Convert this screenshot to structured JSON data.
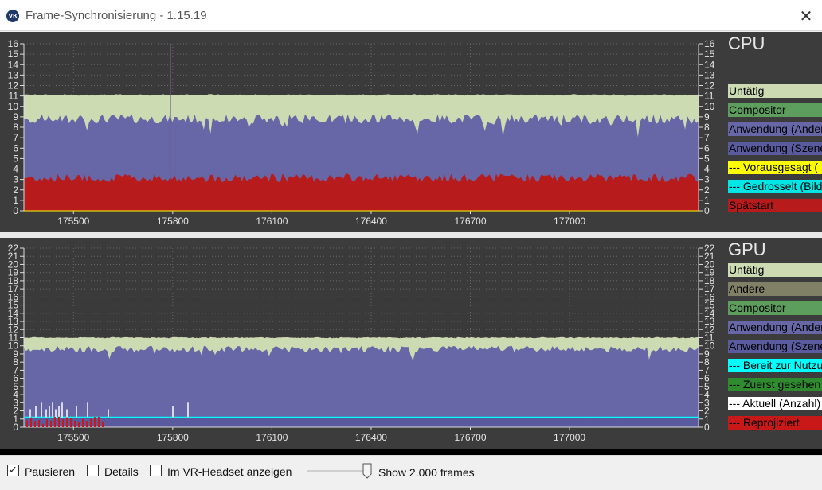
{
  "window": {
    "title": "Frame-Synchronisierung - 1.15.19",
    "app_icon_text": "VR",
    "close_glyph": "✕"
  },
  "colors": {
    "idle": "#ccdbb1",
    "compositor": "#5d9d5d",
    "app_other": "#6767a7",
    "app_scene": "#5a5a9e",
    "predicted": "#ffff00",
    "throttled": "#00e5e5",
    "late_start": "#b81b1b",
    "other": "#808066",
    "ready": "#00ffff",
    "first_seen": "#2e8b2e",
    "current": "#ffffff",
    "reprojected": "#c81818",
    "plot_bg": "#3a3a3a",
    "text": "#e6e6e6"
  },
  "cpu": {
    "legend_title": "CPU",
    "legend": [
      {
        "label": "Untätig",
        "color": "idle"
      },
      {
        "label": "Compositor",
        "color": "compositor"
      },
      {
        "label": "Anwendung (Andere)",
        "color": "app_other"
      },
      {
        "label": "Anwendung (Szene)",
        "color": "app_scene"
      },
      {
        "label": "--- Vorausgesagt (",
        "color": "predicted"
      },
      {
        "label": "--- Gedrosselt (Bild",
        "color": "throttled"
      },
      {
        "label": "Spätstart",
        "color": "late_start"
      }
    ]
  },
  "gpu": {
    "legend_title": "GPU",
    "legend": [
      {
        "label": "Untätig",
        "color": "idle"
      },
      {
        "label": "Andere",
        "color": "other"
      },
      {
        "label": "Compositor",
        "color": "compositor"
      },
      {
        "label": "Anwendung (Andere)",
        "color": "app_other"
      },
      {
        "label": "Anwendung (Szene)",
        "color": "app_scene"
      },
      {
        "label": "--- Bereit zur Nutzung",
        "color": "ready"
      },
      {
        "label": "--- Zuerst gesehen",
        "color": "first_seen"
      },
      {
        "label": "--- Aktuell (Anzahl)",
        "color": "current"
      },
      {
        "label": "--- Reprojiziert",
        "color": "reprojected"
      }
    ]
  },
  "chart_data": [
    {
      "type": "area",
      "name": "CPU",
      "x_ticks": [
        175500,
        175800,
        176100,
        176400,
        176700,
        177000
      ],
      "xlim": [
        175350,
        177390
      ],
      "ylim": [
        0,
        16
      ],
      "y_ticks": [
        0,
        1,
        2,
        3,
        4,
        5,
        6,
        7,
        8,
        9,
        10,
        11,
        12,
        13,
        14,
        15,
        16
      ],
      "grid": true,
      "series": [
        {
          "name": "Spätstart",
          "values": [
            3.3,
            3.2,
            3.1,
            3.0
          ]
        },
        {
          "name": "Anwendung (Szene)",
          "values": [
            8.8,
            8.8,
            8.8,
            8.8
          ]
        },
        {
          "name": "Untätig",
          "values": [
            11.1,
            11.1,
            11.1,
            11.1
          ]
        }
      ]
    },
    {
      "type": "area",
      "name": "GPU",
      "x_ticks": [
        175500,
        175800,
        176100,
        176400,
        176700,
        177000
      ],
      "xlim": [
        175350,
        177390
      ],
      "ylim": [
        0,
        22
      ],
      "y_ticks": [
        0,
        1,
        2,
        3,
        4,
        5,
        6,
        7,
        8,
        9,
        10,
        11,
        12,
        13,
        14,
        15,
        16,
        17,
        18,
        19,
        20,
        21,
        22
      ],
      "grid": true,
      "series": [
        {
          "name": "Bereit zur Nutzung",
          "values": [
            1.2,
            1.2,
            1.2,
            1.2
          ]
        },
        {
          "name": "Anwendung (Szene)",
          "values": [
            9.6,
            9.6,
            9.6,
            9.6
          ]
        },
        {
          "name": "Untätig",
          "values": [
            11.0,
            11.0,
            11.0,
            11.0
          ]
        }
      ]
    }
  ],
  "bottom": {
    "pause_label": "Pausieren",
    "pause_checked": true,
    "details_label": "Details",
    "details_checked": false,
    "vr_label": "Im VR-Headset anzeigen",
    "vr_checked": false,
    "frames_label": "Show 2.000 frames"
  }
}
